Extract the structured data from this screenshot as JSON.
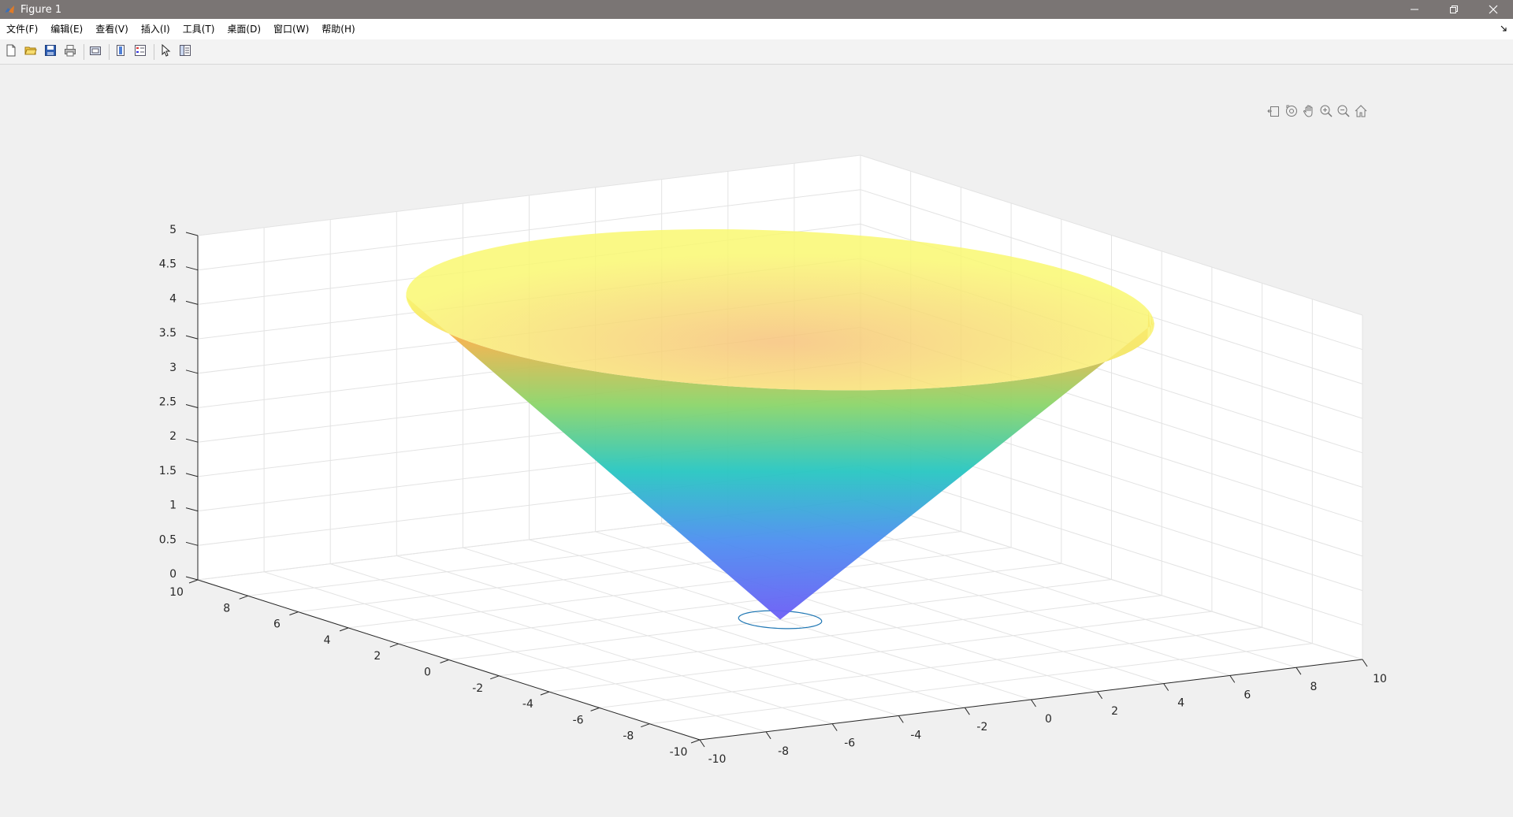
{
  "window": {
    "title": "Figure 1",
    "controls": [
      "minimize-icon",
      "restore-icon",
      "close-icon"
    ]
  },
  "menubar": {
    "items": [
      "文件(F)",
      "编辑(E)",
      "查看(V)",
      "插入(I)",
      "工具(T)",
      "桌面(D)",
      "窗口(W)",
      "帮助(H)"
    ]
  },
  "toolbar": {
    "icons": [
      "new-figure-icon",
      "open-icon",
      "save-icon",
      "print-icon",
      "link-plot-icon",
      "colorbar-icon",
      "legend-icon",
      "select-pointer-icon",
      "property-inspector-icon"
    ]
  },
  "axes_toolbar": {
    "icons": [
      "export-icon",
      "rotate-3d-icon",
      "pan-icon",
      "zoom-in-icon",
      "zoom-out-icon",
      "home-icon"
    ]
  },
  "colors": {
    "titlebar": "#7a7574",
    "surface_low": "#6b5cf5",
    "surface_mid": "#27c6c1",
    "surface_high": "#f9f871",
    "contour_line": "#1f77b4"
  },
  "chart_data": {
    "type": "surface",
    "subtype": "cone",
    "description_function": "z = sqrt(x^2 + y^2) / 2, with contour circle at z = 0 plane",
    "xlim": [
      -10,
      10
    ],
    "ylim": [
      -10,
      10
    ],
    "zlim": [
      0,
      5
    ],
    "xticks": [
      "-10",
      "-8",
      "-6",
      "-4",
      "-2",
      "0",
      "2",
      "4",
      "6",
      "8",
      "10"
    ],
    "yticks": [
      "-10",
      "-8",
      "-6",
      "-4",
      "-2",
      "0",
      "2",
      "4",
      "6",
      "8",
      "10"
    ],
    "zticks": [
      "0",
      "0.5",
      "1",
      "1.5",
      "2",
      "2.5",
      "3",
      "3.5",
      "4",
      "4.5",
      "5"
    ],
    "cone": {
      "apex_z": 0,
      "top_z": 4.5,
      "top_radius": 9
    },
    "contour_circle_radius": 1,
    "grid": true,
    "colormap": "parula-like (purple to cyan to yellow)",
    "title": "",
    "xlabel": "",
    "ylabel": "",
    "zlabel": ""
  }
}
